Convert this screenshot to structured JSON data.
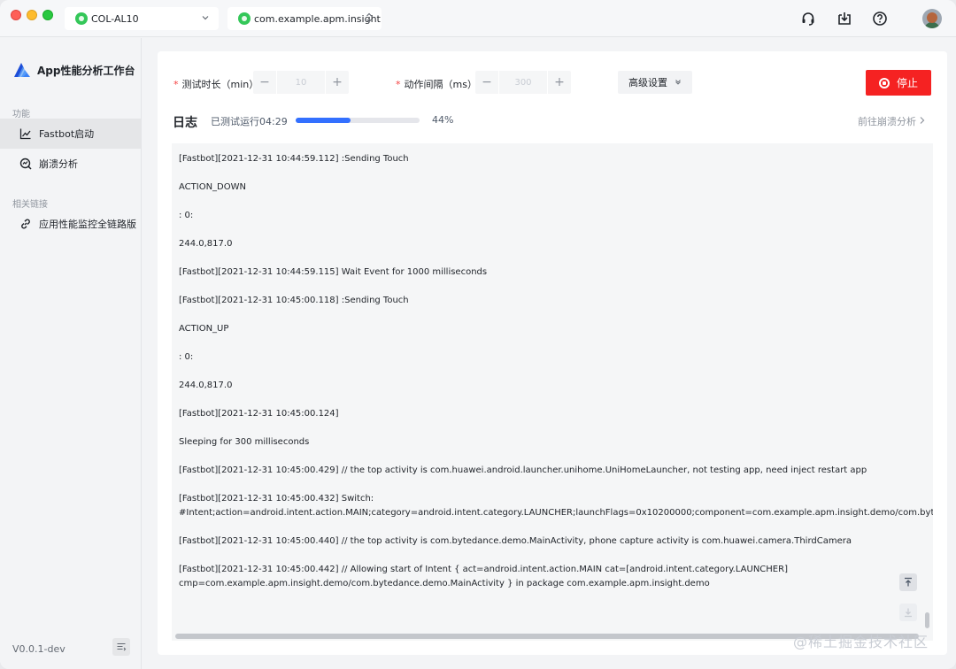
{
  "titlebar": {
    "device": "COL-AL10",
    "app_package": "com.example.apm.insight"
  },
  "icons": {
    "headset": "headset-icon",
    "import": "import-box-icon",
    "help": "help-circle-icon",
    "avatar": "user-avatar"
  },
  "sidebar": {
    "app_title": "App性能分析工作台",
    "section_features": "功能",
    "items": [
      {
        "label": "Fastbot启动",
        "icon": "line-chart-icon"
      },
      {
        "label": "崩溃分析",
        "icon": "crash-search-icon"
      }
    ],
    "section_links": "相关链接",
    "links": [
      {
        "label": "应用性能监控全链路版",
        "icon": "link-icon"
      }
    ],
    "version": "V0.0.1-dev"
  },
  "form": {
    "duration_label": "测试时长（min）",
    "duration_value": "10",
    "interval_label": "动作间隔（ms）",
    "interval_value": "300",
    "advanced_label": "高级设置",
    "stop_label": "停止"
  },
  "log": {
    "title": "日志",
    "run_status": "已测试运行04:29",
    "progress": 0.44,
    "progress_label": "44%",
    "crash_link": "前往崩溃分析",
    "lines": [
      "[Fastbot][2021-12-31 10:44:59.112] :Sending Touch",
      "",
      "ACTION_DOWN",
      "",
      ": 0:",
      "",
      "244.0,817.0",
      "",
      "[Fastbot][2021-12-31 10:44:59.115] Wait Event for 1000 milliseconds",
      "",
      "[Fastbot][2021-12-31 10:45:00.118] :Sending Touch",
      "",
      "ACTION_UP",
      "",
      ": 0:",
      "",
      "244.0,817.0",
      "",
      "[Fastbot][2021-12-31 10:45:00.124]",
      "",
      "Sleeping for 300 milliseconds",
      "",
      "[Fastbot][2021-12-31 10:45:00.429] // the top activity is com.huawei.android.launcher.unihome.UniHomeLauncher, not testing app, need inject restart app",
      "",
      "[Fastbot][2021-12-31 10:45:00.432] Switch:",
      "#Intent;action=android.intent.action.MAIN;category=android.intent.category.LAUNCHER;launchFlags=0x10200000;component=com.example.apm.insight.demo/com.bytedance.demo.MainActivity;end",
      "",
      "[Fastbot][2021-12-31 10:45:00.440] // the top activity is com.bytedance.demo.MainActivity, phone capture activity is com.huawei.camera.ThirdCamera",
      "",
      "[Fastbot][2021-12-31 10:45:00.442] // Allowing start of Intent { act=android.intent.action.MAIN cat=[android.intent.category.LAUNCHER]",
      "cmp=com.example.apm.insight.demo/com.bytedance.demo.MainActivity } in package com.example.apm.insight.demo"
    ]
  },
  "watermark": "@稀土掘金技术社区",
  "colors": {
    "accent": "#3370ff",
    "danger": "#f52222",
    "android_green": "#34c759"
  }
}
